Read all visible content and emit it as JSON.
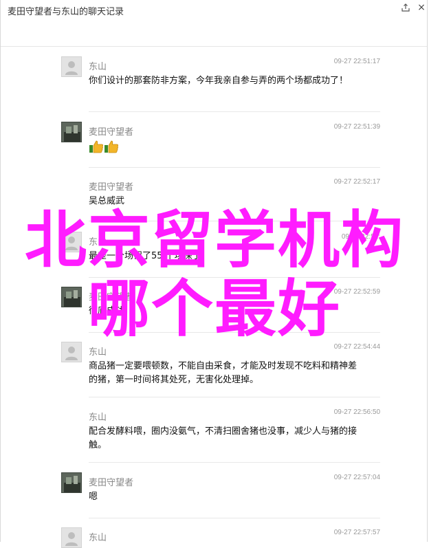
{
  "window": {
    "title": "麦田守望者与东山的聊天记录"
  },
  "messages": [
    {
      "sender": "东山",
      "time": "09-27 22:51:17",
      "avatar": "default",
      "text": "你们设计的那套防非方案，今年我亲自参与弄的两个场都成功了！"
    },
    {
      "sender": "麦田守望者",
      "time": "09-27 22:51:39",
      "avatar": "photo",
      "text": "",
      "emoji": [
        "thumbs-up-icon",
        "thumbs-up-icon"
      ]
    },
    {
      "sender": "麦田守望者",
      "time": "09-27 22:52:17",
      "avatar": "none",
      "text": "吴总威武"
    },
    {
      "sender": "东山",
      "time": "09-27 22:52:",
      "avatar": "default",
      "text": "最差一个场保了55 个场保了"
    },
    {
      "sender": "麦田守望者",
      "time": "09-27 22:52:59",
      "avatar": "photo",
      "text": "彻底成功"
    },
    {
      "sender": "东山",
      "time": "09-27 22:54:44",
      "avatar": "default",
      "text": "商品猪一定要喂顿数，不能自由采食，才能及时发现不吃料和精神差的猪，第一时间将其处死，无害化处理掉。"
    },
    {
      "sender": "东山",
      "time": "09-27 22:56:50",
      "avatar": "none",
      "text": "配合发酵料喂，圈内没氨气，不清扫圈舍猪也没事，减少人与猪的接触。"
    },
    {
      "sender": "麦田守望者",
      "time": "09-27 22:57:04",
      "avatar": "photo",
      "text": "嗯"
    },
    {
      "sender": "东山",
      "time": "09-27 22:57:57",
      "avatar": "default",
      "text": ""
    }
  ],
  "watermark": {
    "line1": "北京留学机构",
    "line2": "哪个最好"
  },
  "colors": {
    "watermark": "#ff1cff",
    "sender": "#888888",
    "time": "#9a9a9a"
  }
}
